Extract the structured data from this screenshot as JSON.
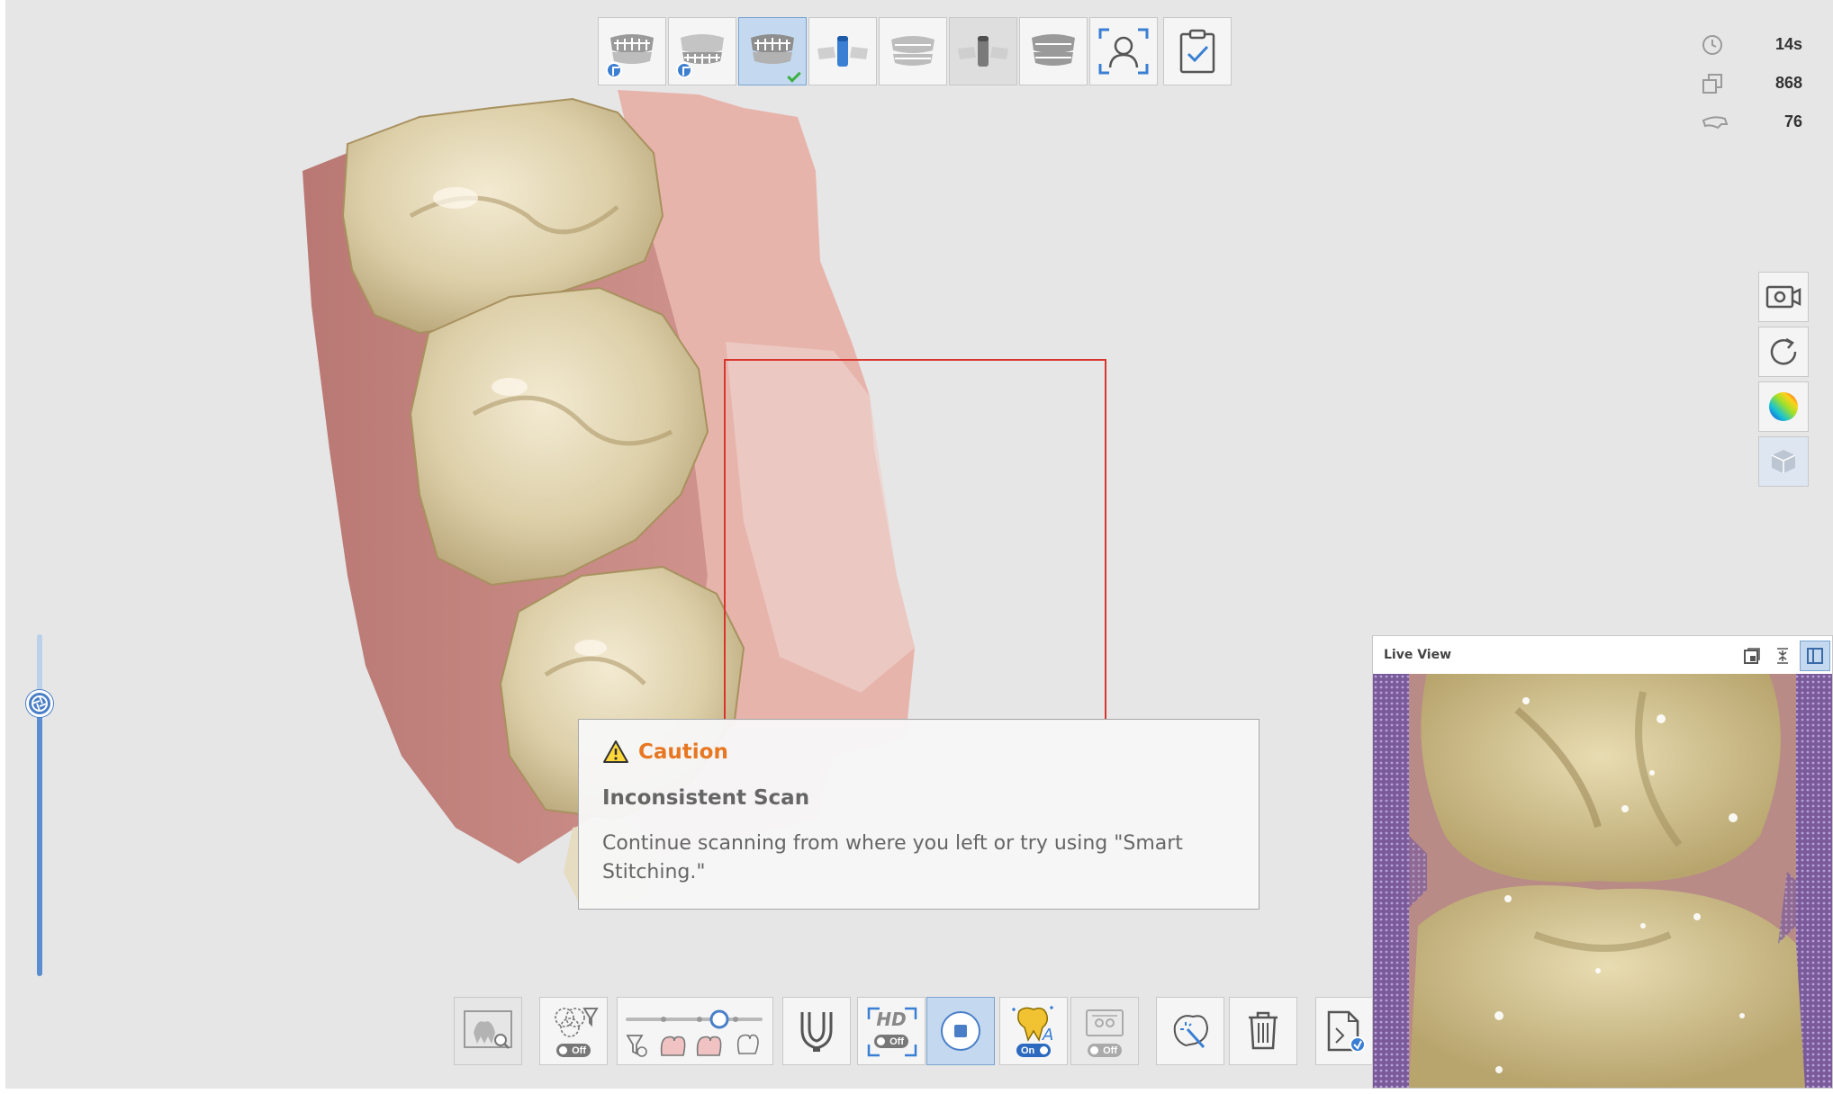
{
  "stats": {
    "scan_time": "14s",
    "image_count": "868",
    "third_value": "76"
  },
  "caution": {
    "title": "Caution",
    "heading": "Inconsistent Scan",
    "message": "Continue scanning from where you left or try using \"Smart Stitching.\""
  },
  "live_view": {
    "title": "Live View"
  },
  "bottom_toolbar": {
    "filter_toggle": "Off",
    "hd_label": "HD",
    "hd_toggle": "Off",
    "ai_toggle": "On",
    "extra_toggle": "Off"
  },
  "colors": {
    "accent_blue": "#4a7fc8",
    "caution_orange": "#e87722",
    "scan_box_red": "#d9352f",
    "active_bg": "#c4d9ef"
  },
  "icons": {
    "stage_bar": [
      "upper-jaw-icon",
      "lower-jaw-icon",
      "upper-jaw-pre-op-icon",
      "scanbody-icon",
      "jaws-icon",
      "abutment-icon",
      "bite-icon",
      "face-scan-icon",
      "checklist-icon"
    ],
    "right_tools": [
      "video-camera-icon",
      "refresh-icon",
      "color-sphere-icon",
      "cube-icon"
    ]
  }
}
